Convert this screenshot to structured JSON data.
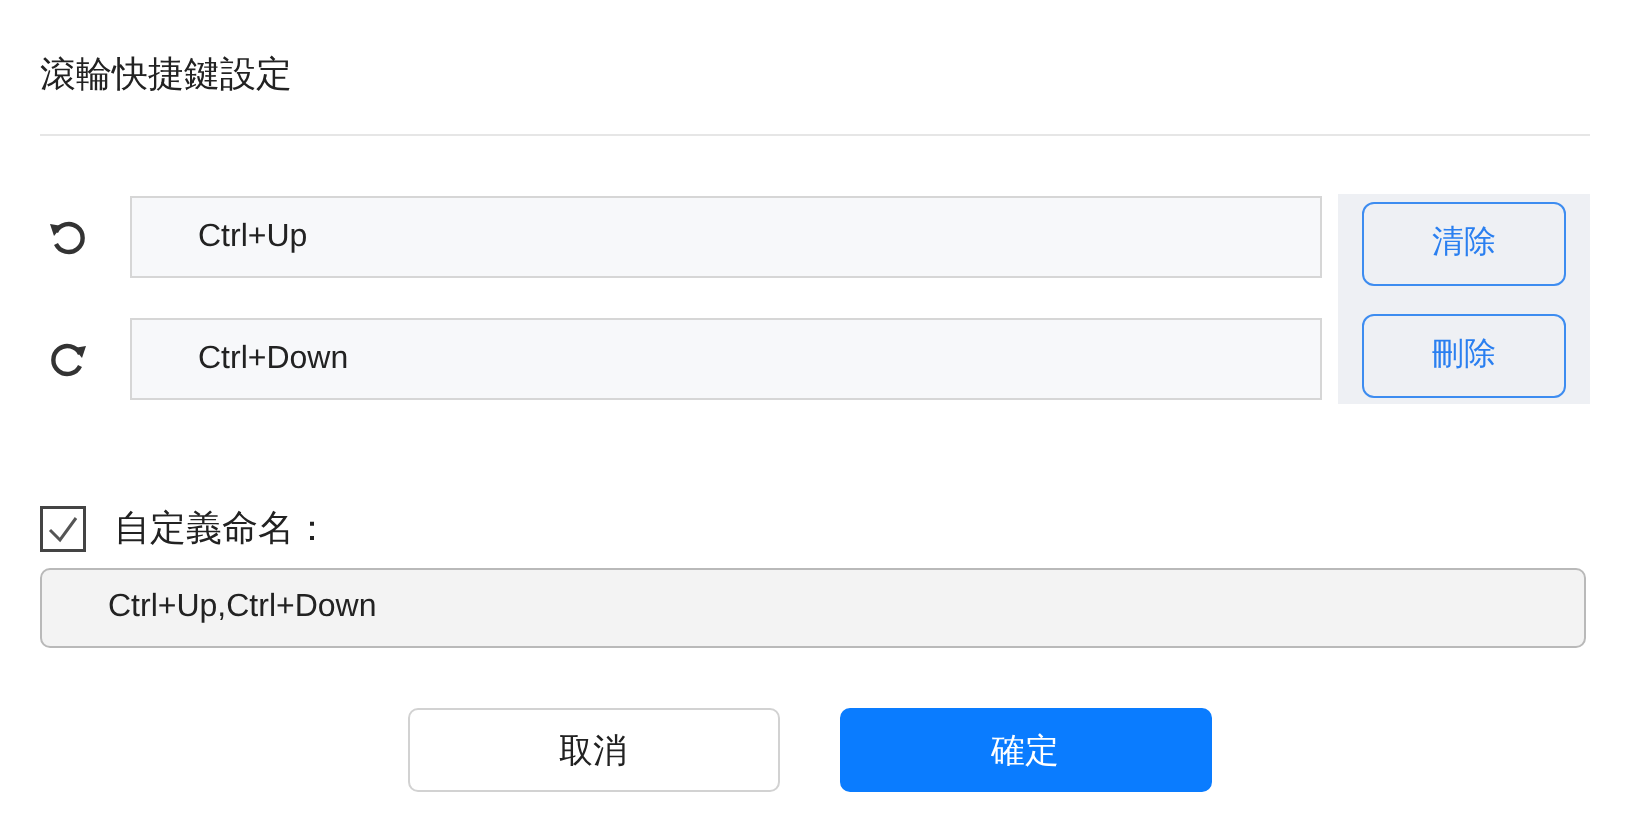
{
  "title": "滾輪快捷鍵設定",
  "shortcuts": [
    {
      "kind": "rotate-left",
      "value": "Ctrl+Up"
    },
    {
      "kind": "rotate-right",
      "value": "Ctrl+Down"
    }
  ],
  "side_buttons": [
    "清除",
    "刪除"
  ],
  "custom_name": {
    "label": "自定義命名：",
    "checked": true,
    "value": "Ctrl+Up,Ctrl+Down"
  },
  "buttons": [
    {
      "label": "取消",
      "kind": "secondary"
    },
    {
      "label": "確定",
      "kind": "primary"
    }
  ]
}
